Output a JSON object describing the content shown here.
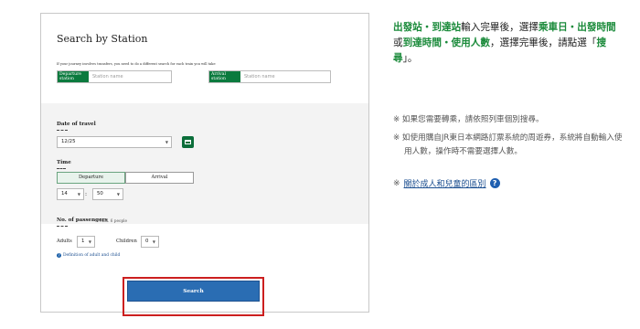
{
  "form": {
    "title": "Search by Station",
    "transfer_note": "If your journey involves transfers, you need to do a different search for each train you will take",
    "departure": {
      "tag": "Departure station",
      "placeholder": "Station name"
    },
    "arrival": {
      "tag": "Arrival station",
      "placeholder": "Station name"
    },
    "date_label": "Date of travel",
    "date_value": "12/25",
    "time_label": "Time",
    "time_options": [
      "Departure",
      "Arrival"
    ],
    "time_selected": "Departure",
    "hour": "14",
    "minute": "50",
    "time_sep": ":",
    "passengers_label": "No. of passengers",
    "passengers_max": "Max. 6 people",
    "adults_label": "Adults",
    "adults_value": "1",
    "children_label": "Children",
    "children_value": "0",
    "definition_link": "Definition of adult and child",
    "search_label": "Search"
  },
  "instructions": {
    "line1_green_a": "出發站・到達站",
    "line1_plain_a": "輸入完畢後，選擇",
    "line1_green_b": "乘車日・出發時間",
    "line1_plain_b": "或",
    "line1_green_c": "到達時間・使用人數",
    "line1_plain_c": "，選擇完畢後，請點選「",
    "line1_green_d": "搜尋",
    "line1_plain_d": "」。",
    "note1": "※ 如果您需要轉乘，請依照列車個別搜尋。",
    "note2": "※ 如使用購自JR東日本網路訂票系統的周遊券，系統將自動輸入使用人數，操作時不需要選擇人數。",
    "link_prefix": "※ ",
    "link_text": "關於成人和兒童的區別"
  },
  "colors": {
    "accent_green": "#1a8a3a",
    "button_blue": "#2a6db3",
    "highlight_red": "#cc1f1f"
  }
}
